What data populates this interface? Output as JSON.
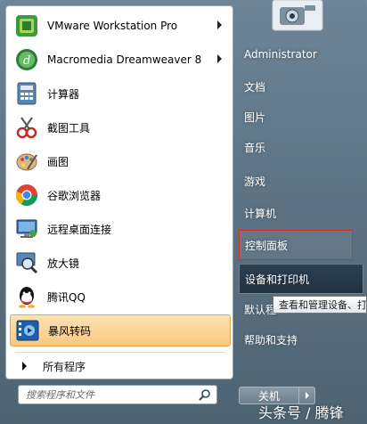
{
  "pinned": [
    {
      "label": "VMware Workstation Pro",
      "icon": "vmware-icon",
      "has_submenu": true
    },
    {
      "label": "Macromedia Dreamweaver 8",
      "icon": "dreamweaver-icon",
      "has_submenu": true
    },
    {
      "label": "计算器",
      "icon": "calculator-icon",
      "has_submenu": false
    },
    {
      "label": "截图工具",
      "icon": "snipping-tool-icon",
      "has_submenu": false
    },
    {
      "label": "画图",
      "icon": "paint-icon",
      "has_submenu": false
    },
    {
      "label": "谷歌浏览器",
      "icon": "chrome-icon",
      "has_submenu": false
    },
    {
      "label": "远程桌面连接",
      "icon": "remote-desktop-icon",
      "has_submenu": false
    },
    {
      "label": "放大镜",
      "icon": "magnifier-icon",
      "has_submenu": false
    },
    {
      "label": "腾讯QQ",
      "icon": "qq-icon",
      "has_submenu": false
    },
    {
      "label": "暴风转码",
      "icon": "storm-codec-icon",
      "has_submenu": false
    }
  ],
  "all_programs": "所有程序",
  "search": {
    "placeholder": "搜索程序和文件"
  },
  "right": {
    "items": [
      {
        "label": "Administrator"
      },
      {
        "label": "文档"
      },
      {
        "label": "图片"
      },
      {
        "label": "音乐"
      },
      {
        "label": "游戏"
      },
      {
        "label": "计算机"
      },
      {
        "label": "控制面板"
      },
      {
        "label": "设备和打印机"
      },
      {
        "label": "默认程"
      },
      {
        "label": "帮助和支持"
      }
    ]
  },
  "tooltip": "查看和管理设备、打",
  "shutdown": {
    "label": "关机"
  },
  "watermark": "头条号 / 腾锋",
  "colors": {
    "highlight": "#fbc77f",
    "selected_border": "#d92b2b"
  }
}
